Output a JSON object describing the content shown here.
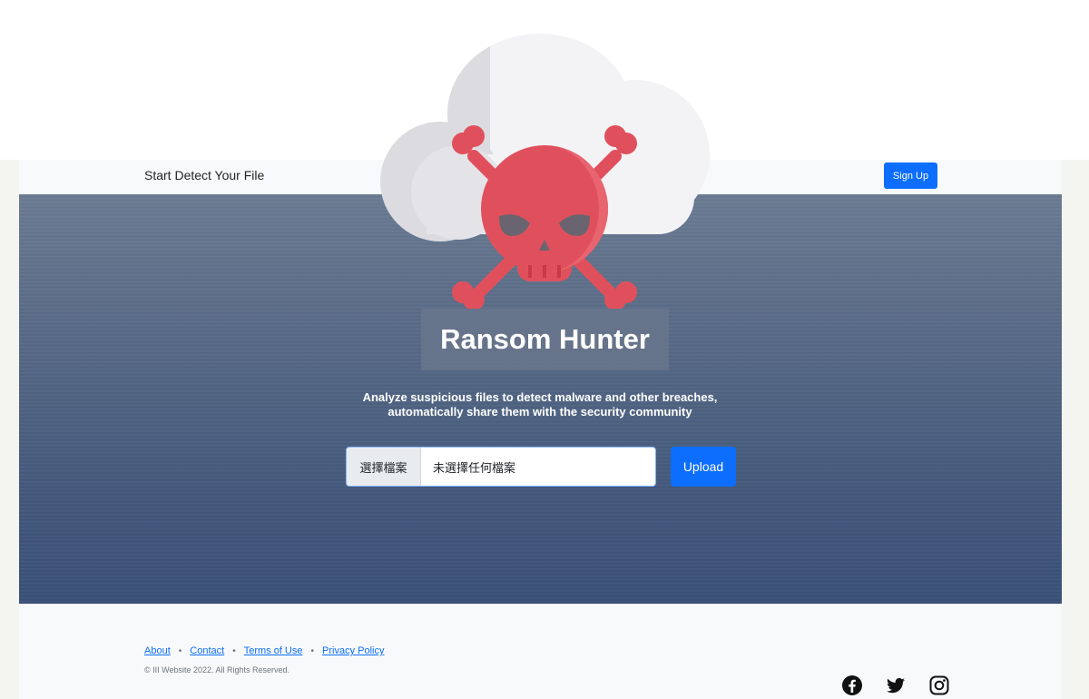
{
  "navbar": {
    "brand": "Start Detect Your File",
    "signup_label": "Sign Up"
  },
  "hero": {
    "title": "Ransom Hunter",
    "subtitle_line1": "Analyze suspicious files to detect malware and other breaches,",
    "subtitle_line2": "automatically share them with the security community"
  },
  "upload": {
    "choose_label": "選擇檔案",
    "file_status": "未選擇任何檔案",
    "upload_label": "Upload"
  },
  "footer": {
    "links": [
      "About",
      "Contact",
      "Terms of Use",
      "Privacy Policy"
    ],
    "copyright": "© III Website 2022. All Rights Reserved.",
    "social_icons": [
      "facebook-icon",
      "twitter-icon",
      "instagram-icon"
    ]
  },
  "colors": {
    "accent": "#0d6efd",
    "skull": "#e0505c",
    "cloud": "#f2f2f4"
  }
}
